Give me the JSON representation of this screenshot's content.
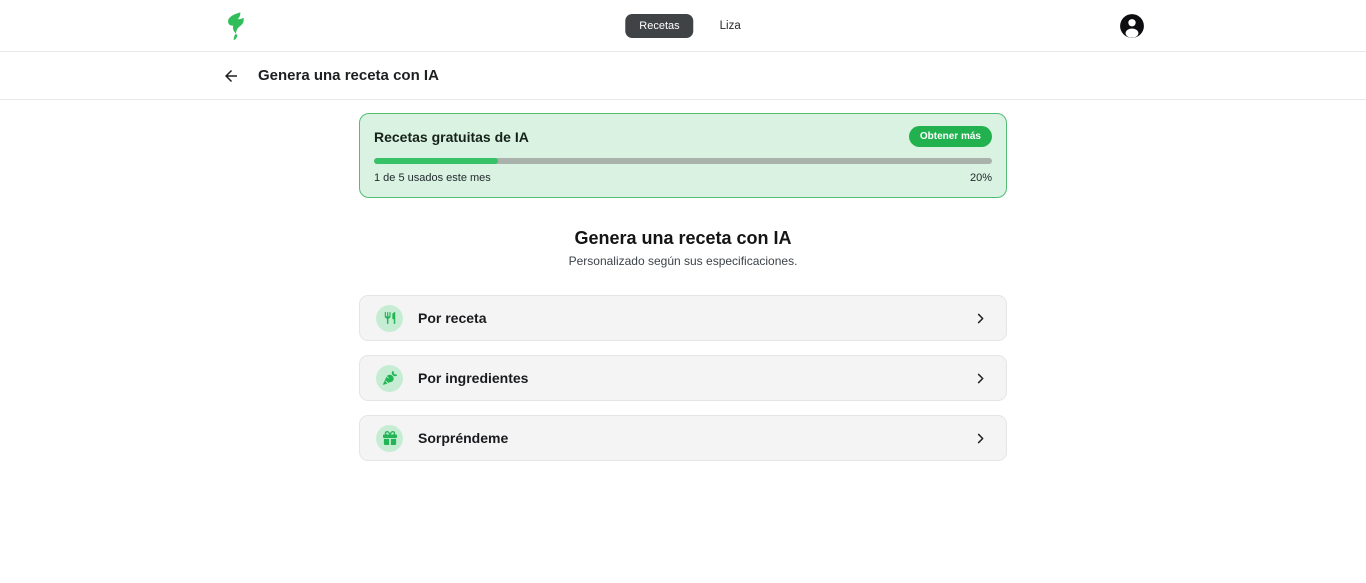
{
  "navbar": {
    "items": [
      {
        "label": "Recetas",
        "active": true
      },
      {
        "label": "Liza",
        "active": false
      }
    ]
  },
  "subheader": {
    "title": "Genera una receta con IA",
    "back_icon": "arrow-left"
  },
  "quota": {
    "title": "Recetas gratuitas de IA",
    "button_label": "Obtener más",
    "used_text": "1 de 5 usados este mes",
    "percent_text": "20%",
    "progress_percent": 20
  },
  "main": {
    "heading": "Genera una receta con IA",
    "subheading": "Personalizado según sus especificaciones.",
    "options": [
      {
        "label": "Por receta",
        "icon": "utensils-icon"
      },
      {
        "label": "Por ingredientes",
        "icon": "carrot-icon"
      },
      {
        "label": "Sorpréndeme",
        "icon": "gift-icon"
      }
    ]
  },
  "colors": {
    "primary_green": "#2fbe5a",
    "pill_green": "#21b14e",
    "quota_bg": "#d9f2e1",
    "quota_border": "#53bd75",
    "progress_fill": "#38c268",
    "progress_track": "#a9b2ab",
    "option_bg": "#f4f4f4",
    "icon_circle_bg": "#c6edd4",
    "nav_button_bg": "#3f4346"
  }
}
